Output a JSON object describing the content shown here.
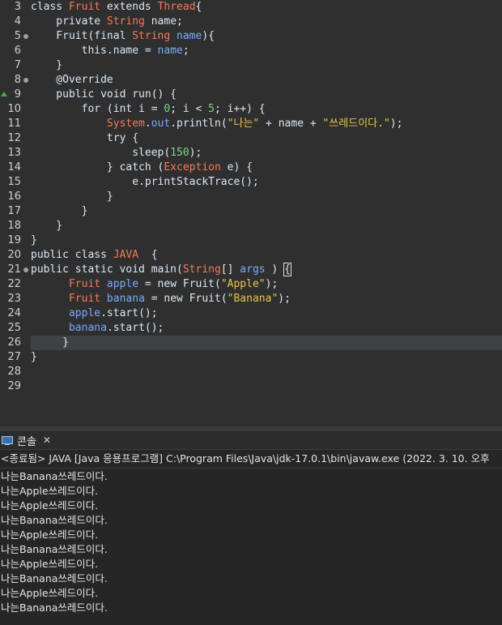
{
  "editor": {
    "lines": [
      {
        "n": "3",
        "tokens": [
          [
            "kw",
            "class "
          ],
          [
            "ty",
            "Fruit"
          ],
          [
            "kw",
            " extends "
          ],
          [
            "ty",
            "Thread"
          ],
          [
            "kw",
            "{"
          ]
        ]
      },
      {
        "n": "4",
        "tokens": [
          [
            "kw",
            "    private "
          ],
          [
            "ty",
            "String"
          ],
          [
            "kw",
            " name;"
          ]
        ]
      },
      {
        "n": "5",
        "fold": true,
        "tokens": [
          [
            "kw",
            "    Fruit(final "
          ],
          [
            "ty",
            "String"
          ],
          [
            "vr",
            " name"
          ],
          [
            "kw",
            "){"
          ]
        ]
      },
      {
        "n": "6",
        "tokens": [
          [
            "kw",
            "        this.name = "
          ],
          [
            "vr",
            "name"
          ],
          [
            "kw",
            ";"
          ]
        ]
      },
      {
        "n": "7",
        "tokens": [
          [
            "kw",
            "    }"
          ]
        ]
      },
      {
        "n": "8",
        "fold": true,
        "tokens": [
          [
            "ann",
            "    @Override"
          ]
        ]
      },
      {
        "n": "9",
        "override": true,
        "tokens": [
          [
            "kw",
            "    public void run() {"
          ]
        ]
      },
      {
        "n": "10",
        "tokens": [
          [
            "kw",
            "        for (int i = "
          ],
          [
            "nm",
            "0"
          ],
          [
            "kw",
            "; i < "
          ],
          [
            "nm",
            "5"
          ],
          [
            "kw",
            "; i++) {"
          ]
        ]
      },
      {
        "n": "11",
        "tokens": [
          [
            "kw",
            "            "
          ],
          [
            "ty",
            "System"
          ],
          [
            "kw",
            "."
          ],
          [
            "vr",
            "out"
          ],
          [
            "kw",
            ".println("
          ],
          [
            "st",
            "\"나는\""
          ],
          [
            "kw",
            " + name + "
          ],
          [
            "st",
            "\"쓰레드이다.\""
          ],
          [
            "kw",
            ");"
          ]
        ]
      },
      {
        "n": "12",
        "tokens": [
          [
            "kw",
            "            try {"
          ]
        ]
      },
      {
        "n": "13",
        "tokens": [
          [
            "kw",
            "                sleep("
          ],
          [
            "nm",
            "150"
          ],
          [
            "kw",
            ");"
          ]
        ]
      },
      {
        "n": "14",
        "tokens": [
          [
            "kw",
            "            } catch ("
          ],
          [
            "ty",
            "Exception"
          ],
          [
            "kw",
            " e) {"
          ]
        ]
      },
      {
        "n": "15",
        "tokens": [
          [
            "kw",
            "                e.printStackTrace();"
          ]
        ]
      },
      {
        "n": "16",
        "tokens": [
          [
            "kw",
            "            }"
          ]
        ]
      },
      {
        "n": "17",
        "tokens": [
          [
            "kw",
            "        }"
          ]
        ]
      },
      {
        "n": "18",
        "tokens": [
          [
            "kw",
            "    }"
          ]
        ]
      },
      {
        "n": "19",
        "tokens": [
          [
            "kw",
            "}"
          ]
        ]
      },
      {
        "n": "20",
        "tokens": [
          [
            "kw",
            "public class "
          ],
          [
            "ty",
            "JAVA"
          ],
          [
            "kw",
            "  {"
          ]
        ]
      },
      {
        "n": "21",
        "fold": true,
        "tokens": [
          [
            "kw",
            "public static void main("
          ],
          [
            "ty",
            "String"
          ],
          [
            "kw",
            "[] "
          ],
          [
            "vr",
            "args"
          ],
          [
            "kw",
            " ) "
          ],
          [
            "br",
            "{"
          ]
        ]
      },
      {
        "n": "22",
        "tokens": [
          [
            "kw",
            "      "
          ],
          [
            "ty",
            "Fruit"
          ],
          [
            "vr",
            " apple"
          ],
          [
            "kw",
            " = new Fruit("
          ],
          [
            "st",
            "\"Apple\""
          ],
          [
            "kw",
            ");"
          ]
        ]
      },
      {
        "n": "23",
        "tokens": [
          [
            "kw",
            "      "
          ],
          [
            "ty",
            "Fruit"
          ],
          [
            "vr",
            " banana"
          ],
          [
            "kw",
            " = new Fruit("
          ],
          [
            "st",
            "\"Banana\""
          ],
          [
            "kw",
            ");"
          ]
        ]
      },
      {
        "n": "24",
        "tokens": [
          [
            "kw",
            "      "
          ],
          [
            "vr",
            "apple"
          ],
          [
            "kw",
            ".start();"
          ]
        ]
      },
      {
        "n": "25",
        "tokens": [
          [
            "kw",
            "      "
          ],
          [
            "vr",
            "banana"
          ],
          [
            "kw",
            ".start();"
          ]
        ]
      },
      {
        "n": "26",
        "current": true,
        "tokens": [
          [
            "kw",
            "     }"
          ]
        ]
      },
      {
        "n": "27",
        "tokens": [
          [
            "kw",
            "}"
          ]
        ]
      },
      {
        "n": "28",
        "tokens": []
      },
      {
        "n": "29",
        "tokens": []
      }
    ]
  },
  "console": {
    "tab_label": "콘솔",
    "tab_icon": "console-monitor-icon",
    "close_icon": "close-icon",
    "status": "<종료됨> JAVA [Java 응용프로그램] C:\\Program Files\\Java\\jdk-17.0.1\\bin\\javaw.exe (2022. 3. 10. 오후",
    "output": [
      "나는Banana쓰레드이다.",
      "나는Apple쓰레드이다.",
      "나는Apple쓰레드이다.",
      "나는Banana쓰레드이다.",
      "나는Apple쓰레드이다.",
      "나는Banana쓰레드이다.",
      "나는Apple쓰레드이다.",
      "나는Banana쓰레드이다.",
      "나는Apple쓰레드이다.",
      "나는Banana쓰레드이다."
    ]
  },
  "colors": {
    "editor_bg": "#2f2f2f",
    "console_bg": "#262626",
    "keyword": "#d9e8f7",
    "type": "#f27b5a",
    "variable": "#79abff",
    "string": "#e7c547",
    "number": "#7fd38a"
  }
}
